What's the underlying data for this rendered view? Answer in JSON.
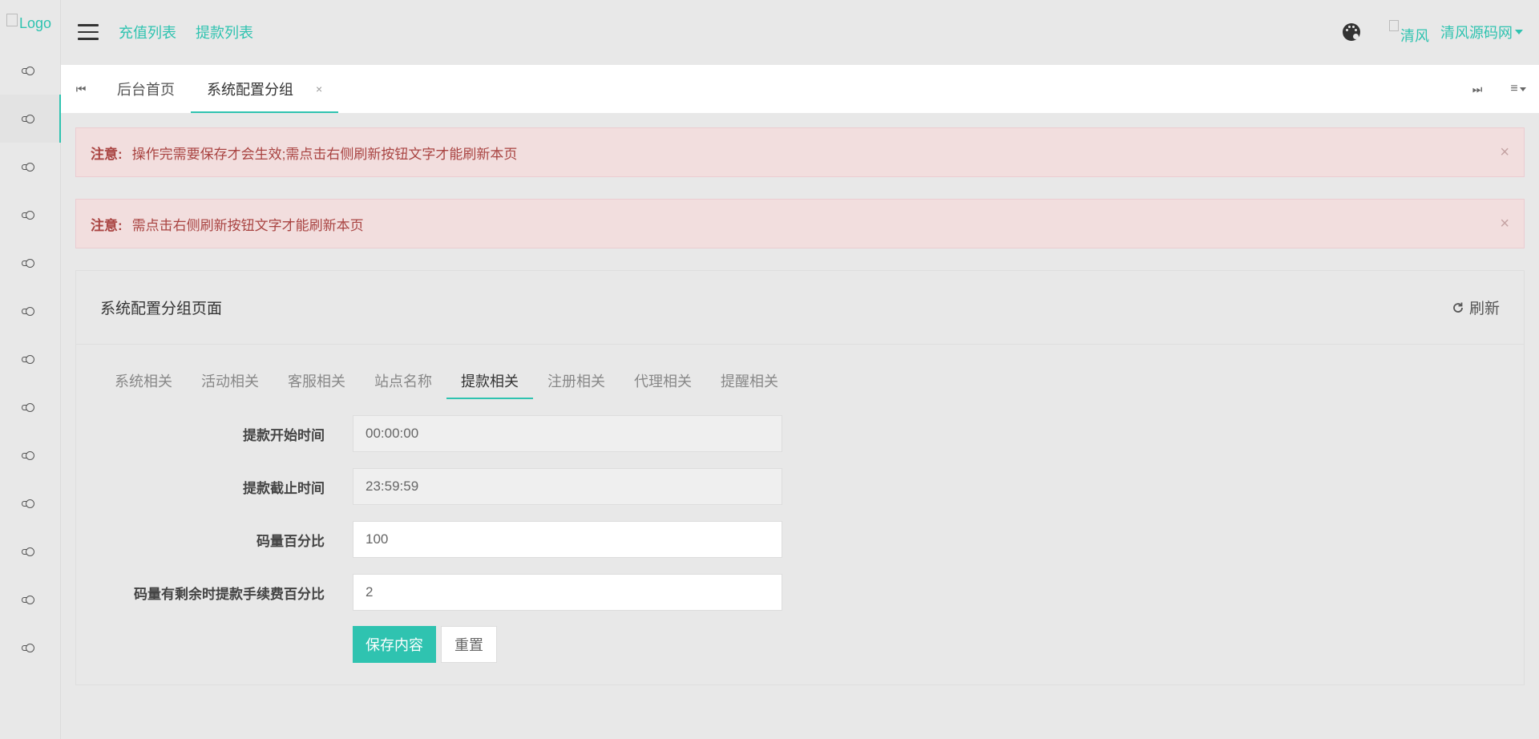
{
  "logo": {
    "alt_text": "Logo"
  },
  "header": {
    "hamburger_icon": "menu-icon",
    "links": [
      "充值列表",
      "提款列表"
    ],
    "theme_icon": "palette-icon",
    "avatar_alt": "清风",
    "user_name": "清风源码网"
  },
  "sidebar": {
    "items": [
      {
        "icon": "circle-icon",
        "active": false
      },
      {
        "icon": "circle-icon",
        "active": true
      },
      {
        "icon": "circle-icon",
        "active": false
      },
      {
        "icon": "circle-icon",
        "active": false
      },
      {
        "icon": "circle-icon",
        "active": false
      },
      {
        "icon": "circle-icon",
        "active": false
      },
      {
        "icon": "circle-icon",
        "active": false
      },
      {
        "icon": "circle-icon",
        "active": false
      },
      {
        "icon": "circle-icon",
        "active": false
      },
      {
        "icon": "circle-icon",
        "active": false
      },
      {
        "icon": "circle-icon",
        "active": false
      },
      {
        "icon": "circle-icon",
        "active": false
      },
      {
        "icon": "circle-icon",
        "active": false
      }
    ]
  },
  "tabbar": {
    "prev_icon": "⏮",
    "next_icon": "⏭",
    "menu_icon": "≡",
    "tabs": [
      {
        "label": "后台首页",
        "active": false
      },
      {
        "label": "系统配置分组",
        "active": true,
        "close": "×"
      }
    ]
  },
  "alerts": [
    {
      "title": "注意:",
      "message": "操作完需要保存才会生效;需点击右侧刷新按钮文字才能刷新本页",
      "close": "×"
    },
    {
      "title": "注意:",
      "message": "需点击右侧刷新按钮文字才能刷新本页",
      "close": "×"
    }
  ],
  "panel": {
    "title": "系统配置分组页面",
    "refresh_label": "刷新",
    "tabs": [
      "系统相关",
      "活动相关",
      "客服相关",
      "站点名称",
      "提款相关",
      "注册相关",
      "代理相关",
      "提醒相关"
    ],
    "active_tab": 4,
    "fields": [
      {
        "label": "提款开始时间",
        "value": "00:00:00",
        "readonly": true
      },
      {
        "label": "提款截止时间",
        "value": "23:59:59",
        "readonly": true
      },
      {
        "label": "码量百分比",
        "value": "100",
        "readonly": false
      },
      {
        "label": "码量有剩余时提款手续费百分比",
        "value": "2",
        "readonly": false
      }
    ],
    "save_label": "保存内容",
    "reset_label": "重置"
  },
  "colors": {
    "accent": "#2fc3b0",
    "alert_bg": "#f2dede",
    "alert_text": "#a94442"
  }
}
